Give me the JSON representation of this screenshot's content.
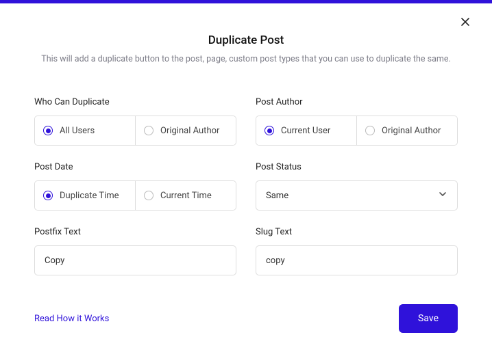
{
  "header": {
    "title": "Duplicate Post",
    "subtitle": "This will add a duplicate button to the post, page, custom post types that you can use to duplicate the same."
  },
  "fields": {
    "who_can_duplicate": {
      "label": "Who Can Duplicate",
      "options": [
        "All Users",
        "Original Author"
      ],
      "selected": 0
    },
    "post_author": {
      "label": "Post Author",
      "options": [
        "Current User",
        "Original Author"
      ],
      "selected": 0
    },
    "post_date": {
      "label": "Post Date",
      "options": [
        "Duplicate Time",
        "Current Time"
      ],
      "selected": 0
    },
    "post_status": {
      "label": "Post Status",
      "value": "Same"
    },
    "postfix_text": {
      "label": "Postfix Text",
      "value": "Copy"
    },
    "slug_text": {
      "label": "Slug Text",
      "value": "copy"
    }
  },
  "footer": {
    "link": "Read How it Works",
    "save": "Save"
  }
}
